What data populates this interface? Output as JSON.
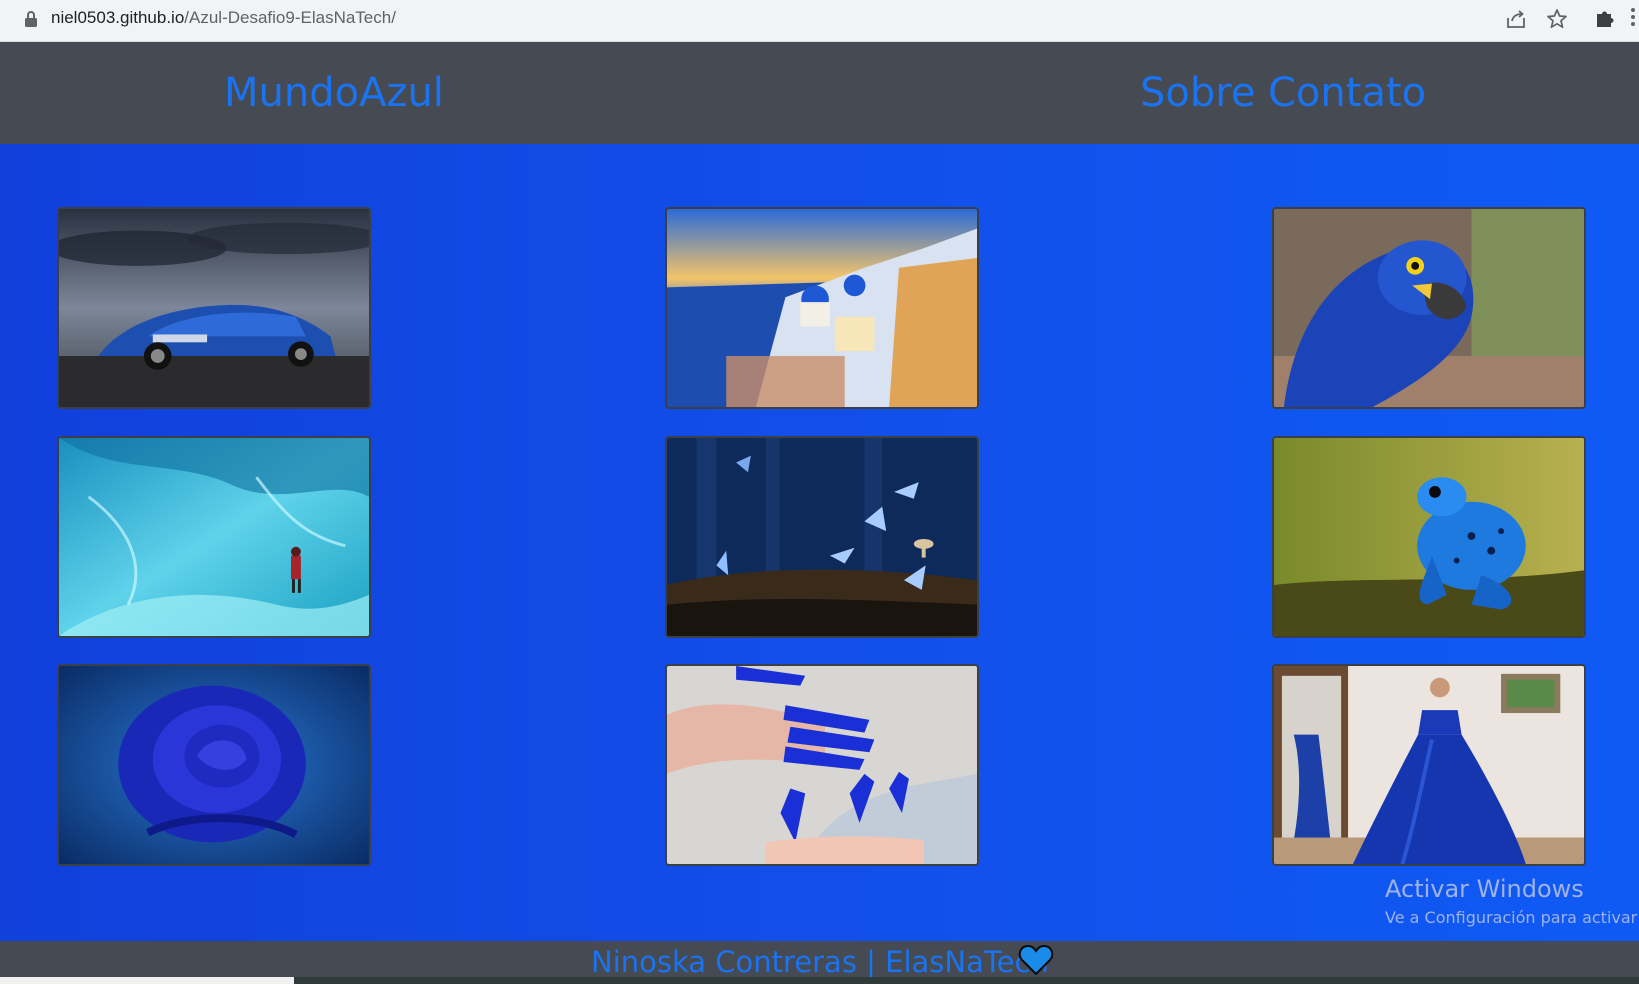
{
  "browser": {
    "url_host": "niel0503.github.io",
    "url_path": "/Azul-Desafio9-ElasNaTech/"
  },
  "navbar": {
    "brand": "MundoAzul",
    "links": [
      "Sobre",
      "Contato"
    ]
  },
  "gallery": {
    "items": [
      {
        "name": "blue-car-image"
      },
      {
        "name": "santorini-image"
      },
      {
        "name": "blue-macaw-image"
      },
      {
        "name": "ice-cave-image"
      },
      {
        "name": "blue-butterflies-image"
      },
      {
        "name": "blue-frog-image"
      },
      {
        "name": "blue-rose-image"
      },
      {
        "name": "blue-nails-image"
      },
      {
        "name": "blue-dress-image"
      }
    ]
  },
  "watermark": {
    "title": "Activar Windows",
    "subtitle": "Ve a Configuración para activar Windows."
  },
  "footer": {
    "text": "Ninoska Contreras | ElasNaTech"
  },
  "colors": {
    "accent": "#1a73f0",
    "navbar": "#464a52",
    "background": "#1046e6"
  }
}
